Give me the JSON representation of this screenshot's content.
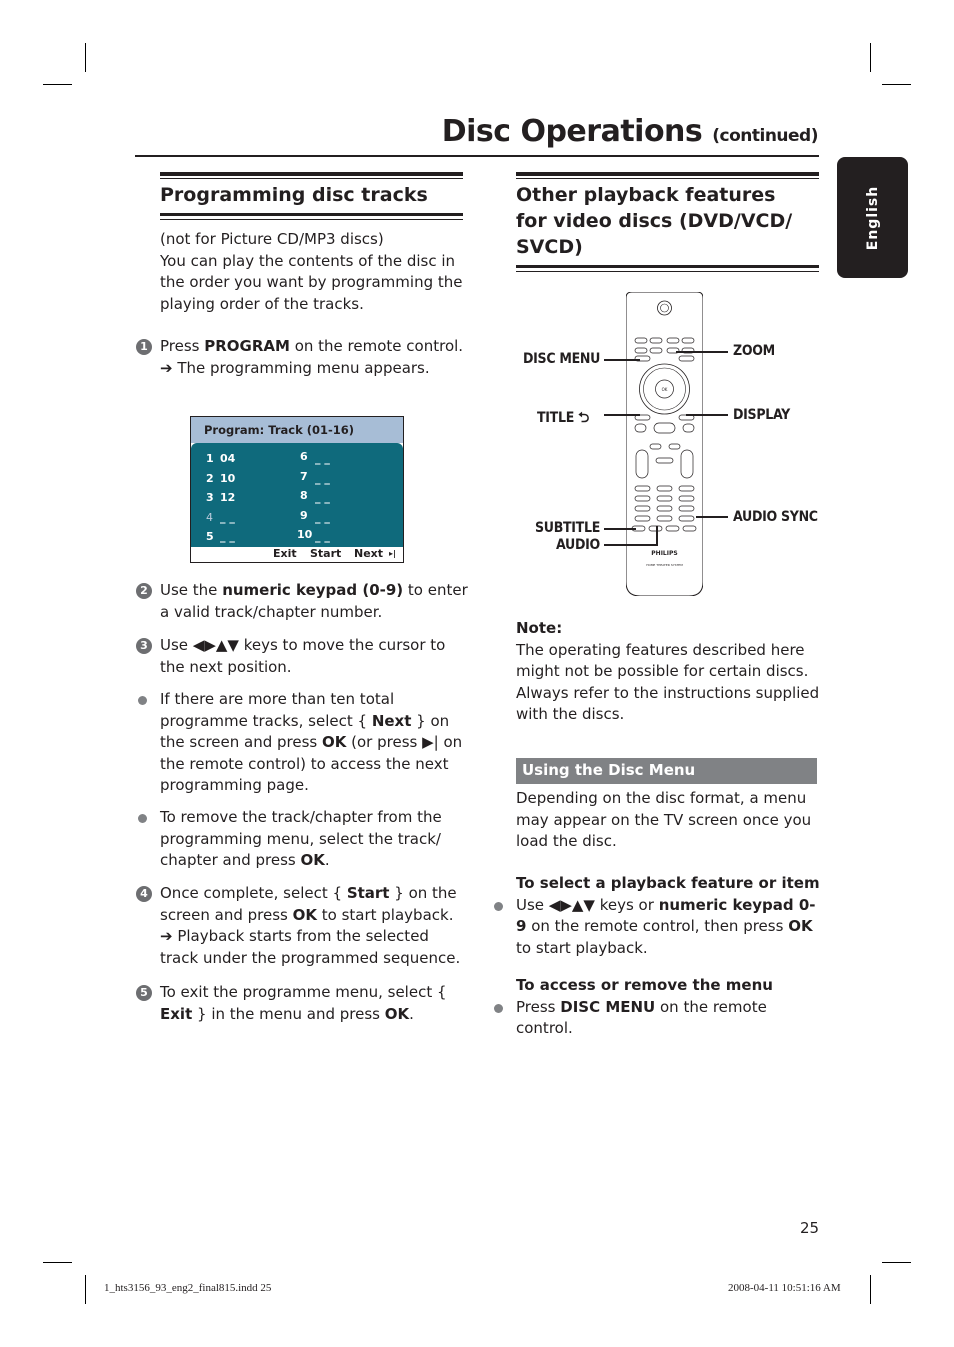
{
  "header": {
    "title": "Disc Operations",
    "title_suffix": "(continued)"
  },
  "language_tab": "English",
  "left_section": {
    "heading": "Programming disc tracks",
    "intro_1": "(not for Picture CD/MP3 discs)",
    "intro_2": "You can play the contents of the disc in the order you want by programming the playing order of the tracks.",
    "steps": [
      {
        "num": "1",
        "pre": "Press ",
        "bold": "PROGRAM",
        "post": " on the remote control.",
        "result": "The programming menu appears."
      },
      {
        "num": "2",
        "pre": "Use the ",
        "bold": "numeric keypad (0-9)",
        "post": " to enter a valid track/chapter number."
      },
      {
        "num": "3",
        "pre": "Use ",
        "keys": "◀▶▲▼",
        "post": " keys to move the cursor to the next position."
      },
      {
        "num": "4",
        "pre": "Once complete, select { ",
        "bold": "Start",
        "mid": " } on the screen and press ",
        "bold2": "OK",
        "post": " to start playback.",
        "result": "Playback starts from the selected track under the programmed sequence."
      },
      {
        "num": "5",
        "pre": "To exit the programme menu, select { ",
        "bold": "Exit",
        "mid": " } in the menu and press ",
        "bold2": "OK",
        "post": "."
      }
    ],
    "bullets": [
      {
        "pre": "If there are more than ten total programme tracks, select { ",
        "bold": "Next",
        "mid": " } on the screen and press ",
        "bold2": "OK",
        "mid2": " (or press ",
        "icon": "▶|",
        "post": " on the remote control) to access the next programming page."
      },
      {
        "pre": "To remove the track/chapter from the programming menu, select the track/ chapter and press ",
        "bold": "OK",
        "post": "."
      }
    ],
    "program_screen": {
      "title": "Program: Track (01-16)",
      "left_col": [
        {
          "idx": "1",
          "val": "04"
        },
        {
          "idx": "2",
          "val": "10"
        },
        {
          "idx": "3",
          "val": "12"
        },
        {
          "idx": "4",
          "val": "_ _"
        },
        {
          "idx": "5",
          "val": "_ _"
        }
      ],
      "right_col": [
        {
          "idx": "6",
          "val": "_ _"
        },
        {
          "idx": "7",
          "val": "_ _"
        },
        {
          "idx": "8",
          "val": "_ _"
        },
        {
          "idx": "9",
          "val": "_ _"
        },
        {
          "idx": "10",
          "val": "_ _"
        }
      ],
      "buttons": [
        "Exit",
        "Start",
        "Next"
      ],
      "next_icon": "▸|",
      "colors": {
        "header": "#a7bdd6",
        "body": "#0f6a7c"
      }
    }
  },
  "right_section": {
    "heading_lines": [
      "Other playback features",
      "for video discs (DVD/VCD/",
      "SVCD)"
    ],
    "remote_callouts": {
      "disc_menu": "DISC MENU",
      "zoom": "ZOOM",
      "title": "TITLE",
      "display": "DISPLAY",
      "subtitle": "SUBTITLE",
      "audio": "AUDIO",
      "audio_sync": "AUDIO SYNC",
      "brand": "PHILIPS",
      "model": "HOME THEATER SYSTEM",
      "ok": "OK"
    },
    "note_label": "Note:",
    "note_text": "The operating features described here might not be possible for certain discs. Always refer to the instructions supplied with the discs.",
    "subsection_title": "Using the Disc Menu",
    "subsection_intro": "Depending on the disc format, a menu may appear on the TV screen once you load the disc.",
    "select_heading": "To select a playback feature or item",
    "select_bullet": {
      "pre": "Use ",
      "keys": "◀▶▲▼",
      "mid": " keys or ",
      "bold": "numeric keypad 0-9",
      "mid2": " on the remote control, then press ",
      "bold2": "OK",
      "post": " to start playback."
    },
    "access_heading": "To access or remove the menu",
    "access_bullet": {
      "pre": "Press ",
      "bold": "DISC MENU",
      "post": " on the remote control."
    }
  },
  "page_number": "25",
  "print_footer": {
    "file": "1_hts3156_93_eng2_final815.indd   25",
    "timestamp": "2008-04-11   10:51:16 AM"
  }
}
